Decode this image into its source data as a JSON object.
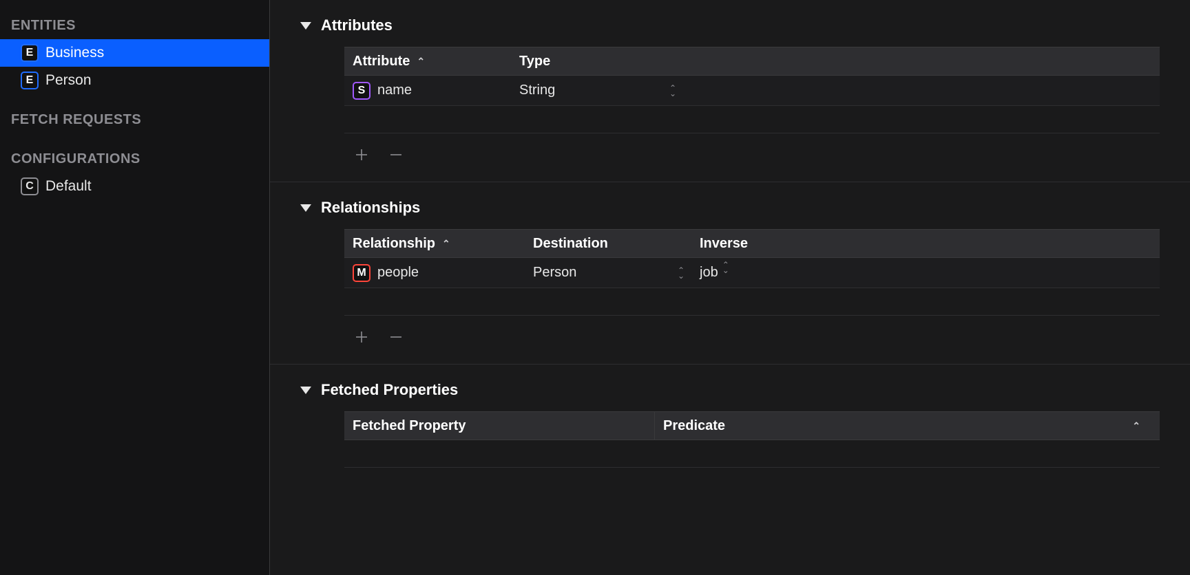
{
  "sidebar": {
    "entities_header": "ENTITIES",
    "fetch_requests_header": "FETCH REQUESTS",
    "configurations_header": "CONFIGURATIONS",
    "entities": [
      {
        "name": "Business",
        "selected": true
      },
      {
        "name": "Person",
        "selected": false
      }
    ],
    "configurations": [
      {
        "name": "Default"
      }
    ]
  },
  "main": {
    "attributes": {
      "title": "Attributes",
      "columns": {
        "attribute": "Attribute",
        "type": "Type"
      },
      "rows": [
        {
          "badge": "S",
          "name": "name",
          "type": "String"
        }
      ]
    },
    "relationships": {
      "title": "Relationships",
      "columns": {
        "relationship": "Relationship",
        "destination": "Destination",
        "inverse": "Inverse"
      },
      "rows": [
        {
          "badge": "M",
          "name": "people",
          "destination": "Person",
          "inverse": "job"
        }
      ]
    },
    "fetched_properties": {
      "title": "Fetched Properties",
      "columns": {
        "fetched_property": "Fetched Property",
        "predicate": "Predicate"
      },
      "rows": []
    }
  }
}
